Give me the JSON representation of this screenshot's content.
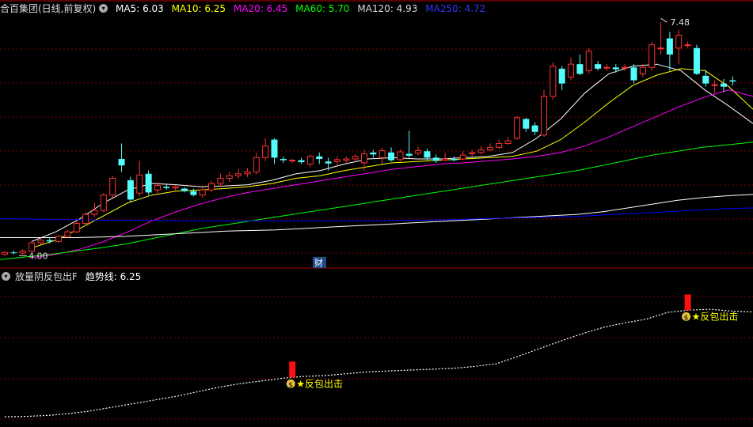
{
  "main_header": {
    "title": "合百集团(日线,前复权)",
    "ma5": "MA5: 6.03",
    "ma10": "MA10: 6.25",
    "ma20": "MA20: 6.45",
    "ma60": "MA60: 5.70",
    "ma120": "MA120: 4.93",
    "ma250": "MA250: 4.72"
  },
  "sub_header": {
    "indicator": "放量阴反包出F",
    "trend": "趋势线: 6.25"
  },
  "colors": {
    "background": "#000000",
    "up": "#ff3232",
    "down": "#54fcfc",
    "ma5": "#ffffff",
    "ma10": "#ffff00",
    "ma20": "#ff00ff",
    "ma60": "#00ff00",
    "ma120": "#ffffff",
    "ma250": "#0000ff",
    "grid": "#800000",
    "signal_text": "#ffff00"
  },
  "chart_data": {
    "type": "candlestick",
    "price_range": [
      3.8,
      7.7
    ],
    "high_label": "7.48",
    "low_label": "4.00",
    "event_marker": "财",
    "candles": [
      [
        4.0,
        4.03,
        4.05,
        3.98
      ],
      [
        4.03,
        4.02,
        4.06,
        4.0
      ],
      [
        4.02,
        4.05,
        4.08,
        4.0
      ],
      [
        4.05,
        4.18,
        4.2,
        4.03
      ],
      [
        4.18,
        4.22,
        4.25,
        4.15
      ],
      [
        4.22,
        4.2,
        4.26,
        4.17
      ],
      [
        4.2,
        4.28,
        4.3,
        4.18
      ],
      [
        4.28,
        4.35,
        4.38,
        4.25
      ],
      [
        4.35,
        4.48,
        4.52,
        4.33
      ],
      [
        4.48,
        4.62,
        4.66,
        4.45
      ],
      [
        4.62,
        4.68,
        4.8,
        4.58
      ],
      [
        4.68,
        4.92,
        4.95,
        4.65
      ],
      [
        4.92,
        5.18,
        5.22,
        4.88
      ],
      [
        5.48,
        5.38,
        5.72,
        5.28
      ],
      [
        5.15,
        4.85,
        5.2,
        4.8
      ],
      [
        4.95,
        5.23,
        5.45,
        4.9
      ],
      [
        5.25,
        4.96,
        5.3,
        4.92
      ],
      [
        5.0,
        5.07,
        5.12,
        4.95
      ],
      [
        5.05,
        5.03,
        5.1,
        5.0
      ],
      [
        5.03,
        5.05,
        5.08,
        4.99
      ],
      [
        5.02,
        4.98,
        5.04,
        4.96
      ],
      [
        4.98,
        4.92,
        5.02,
        4.9
      ],
      [
        4.92,
        5.0,
        5.05,
        4.88
      ],
      [
        5.0,
        5.1,
        5.14,
        4.97
      ],
      [
        5.1,
        5.18,
        5.25,
        5.05
      ],
      [
        5.18,
        5.22,
        5.28,
        5.12
      ],
      [
        5.22,
        5.25,
        5.32,
        5.18
      ],
      [
        5.25,
        5.28,
        5.34,
        5.2
      ],
      [
        5.28,
        5.5,
        5.58,
        5.24
      ],
      [
        5.5,
        5.68,
        5.8,
        5.45
      ],
      [
        5.78,
        5.5,
        5.8,
        5.4
      ],
      [
        5.48,
        5.46,
        5.52,
        5.42
      ],
      [
        5.45,
        5.46,
        5.48,
        5.42
      ],
      [
        5.46,
        5.43,
        5.5,
        5.4
      ],
      [
        5.4,
        5.52,
        5.55,
        5.35
      ],
      [
        5.52,
        5.48,
        5.58,
        5.4
      ],
      [
        5.44,
        5.41,
        5.5,
        5.3
      ],
      [
        5.44,
        5.47,
        5.52,
        5.38
      ],
      [
        5.46,
        5.48,
        5.52,
        5.42
      ],
      [
        5.48,
        5.52,
        5.55,
        5.45
      ],
      [
        5.42,
        5.56,
        5.62,
        5.3
      ],
      [
        5.58,
        5.55,
        5.62,
        5.5
      ],
      [
        5.5,
        5.61,
        5.65,
        5.4
      ],
      [
        5.58,
        5.46,
        5.66,
        5.44
      ],
      [
        5.47,
        5.59,
        5.63,
        5.44
      ],
      [
        5.56,
        5.53,
        5.92,
        5.5
      ],
      [
        5.57,
        5.61,
        5.67,
        5.54
      ],
      [
        5.6,
        5.5,
        5.64,
        5.46
      ],
      [
        5.5,
        5.45,
        5.55,
        5.42
      ],
      [
        5.46,
        5.48,
        5.58,
        5.44
      ],
      [
        5.48,
        5.46,
        5.52,
        5.44
      ],
      [
        5.48,
        5.54,
        5.6,
        5.46
      ],
      [
        5.56,
        5.58,
        5.62,
        5.52
      ],
      [
        5.58,
        5.62,
        5.68,
        5.55
      ],
      [
        5.62,
        5.66,
        5.72,
        5.6
      ],
      [
        5.66,
        5.72,
        5.78,
        5.64
      ],
      [
        5.72,
        5.76,
        5.82,
        5.7
      ],
      [
        5.8,
        6.12,
        6.15,
        5.78
      ],
      [
        6.1,
        5.95,
        6.12,
        5.9
      ],
      [
        6.0,
        5.9,
        6.05,
        5.85
      ],
      [
        5.85,
        6.45,
        6.55,
        5.82
      ],
      [
        6.45,
        6.92,
        6.98,
        6.4
      ],
      [
        6.88,
        6.65,
        6.92,
        6.55
      ],
      [
        6.75,
        6.95,
        7.05,
        6.7
      ],
      [
        6.95,
        6.8,
        7.1,
        6.78
      ],
      [
        6.85,
        7.15,
        7.2,
        6.8
      ],
      [
        6.95,
        6.88,
        7.0,
        6.85
      ],
      [
        6.9,
        6.9,
        6.95,
        6.85
      ],
      [
        6.9,
        6.87,
        6.95,
        6.82
      ],
      [
        6.9,
        6.9,
        6.95,
        6.85
      ],
      [
        6.9,
        6.7,
        6.95,
        6.65
      ],
      [
        6.8,
        6.9,
        6.95,
        6.75
      ],
      [
        6.9,
        7.25,
        7.3,
        6.85
      ],
      [
        7.2,
        7.2,
        7.6,
        7.1
      ],
      [
        7.35,
        7.1,
        7.45,
        6.85
      ],
      [
        7.2,
        7.4,
        7.48,
        6.95
      ],
      [
        7.25,
        7.25,
        7.3,
        7.2
      ],
      [
        7.2,
        6.8,
        7.25,
        6.78
      ],
      [
        6.77,
        6.65,
        6.86,
        6.6
      ],
      [
        6.63,
        6.63,
        6.7,
        6.5
      ],
      [
        6.65,
        6.6,
        6.72,
        6.52
      ],
      [
        6.7,
        6.68,
        6.76,
        6.62
      ]
    ],
    "ma_labels": [
      "MA5",
      "MA10",
      "MA20",
      "MA60",
      "MA120",
      "MA250"
    ],
    "ma_values": {
      "MA5": [
        4.2,
        4.35,
        4.55,
        4.8,
        5.0,
        5.1,
        5.08,
        5.05,
        5.06,
        5.08,
        5.15,
        5.25,
        5.3,
        5.4,
        5.48,
        5.5,
        5.48,
        5.48,
        5.5,
        5.52,
        5.58,
        5.8,
        6.1,
        6.5,
        6.8,
        6.92,
        6.95,
        6.85,
        6.55,
        6.3,
        6.03
      ],
      "MA10": [
        4.1,
        4.22,
        4.4,
        4.6,
        4.8,
        4.92,
        4.98,
        5.0,
        5.02,
        5.05,
        5.1,
        5.18,
        5.22,
        5.3,
        5.36,
        5.42,
        5.44,
        5.46,
        5.48,
        5.5,
        5.52,
        5.6,
        5.78,
        6.05,
        6.35,
        6.62,
        6.78,
        6.88,
        6.85,
        6.6,
        6.25
      ],
      "MA20": [
        3.95,
        4.0,
        4.08,
        4.2,
        4.35,
        4.52,
        4.66,
        4.78,
        4.88,
        4.96,
        5.02,
        5.08,
        5.14,
        5.2,
        5.26,
        5.32,
        5.36,
        5.4,
        5.42,
        5.45,
        5.48,
        5.52,
        5.58,
        5.68,
        5.82,
        5.98,
        6.14,
        6.3,
        6.44,
        6.55,
        6.45
      ],
      "MA60": [
        3.92,
        3.96,
        4.0,
        4.05,
        4.1,
        4.16,
        4.24,
        4.32,
        4.4,
        4.46,
        4.52,
        4.58,
        4.64,
        4.7,
        4.76,
        4.82,
        4.88,
        4.94,
        5.0,
        5.06,
        5.12,
        5.18,
        5.24,
        5.3,
        5.38,
        5.46,
        5.54,
        5.6,
        5.66,
        5.7,
        5.74
      ],
      "MA120": [
        4.26,
        4.26,
        4.26,
        4.26,
        4.27,
        4.28,
        4.3,
        4.32,
        4.34,
        4.36,
        4.37,
        4.38,
        4.4,
        4.42,
        4.44,
        4.46,
        4.48,
        4.5,
        4.52,
        4.54,
        4.56,
        4.58,
        4.6,
        4.62,
        4.66,
        4.72,
        4.78,
        4.84,
        4.88,
        4.91,
        4.93
      ],
      "MA250": [
        4.55,
        4.55,
        4.54,
        4.54,
        4.53,
        4.53,
        4.53,
        4.52,
        4.52,
        4.52,
        4.52,
        4.52,
        4.52,
        4.52,
        4.52,
        4.52,
        4.53,
        4.53,
        4.54,
        4.55,
        4.56,
        4.57,
        4.58,
        4.59,
        4.61,
        4.63,
        4.65,
        4.67,
        4.69,
        4.71,
        4.72
      ]
    },
    "sub_range": [
      4.5,
      7.2
    ],
    "trend_line": [
      4.55,
      4.56,
      4.58,
      4.62,
      4.68,
      4.76,
      4.84,
      4.92,
      5.0,
      5.1,
      5.2,
      5.28,
      5.34,
      5.4,
      5.44,
      5.46,
      5.5,
      5.54,
      5.56,
      5.58,
      5.6,
      5.62,
      5.66,
      5.72,
      5.88,
      6.05,
      6.22,
      6.38,
      6.52,
      6.62,
      6.7,
      6.85,
      6.9,
      6.92,
      6.88,
      6.86
    ],
    "signals": [
      {
        "candle": 32,
        "label": "反包出击"
      },
      {
        "candle": 76,
        "label": "反包出击"
      }
    ]
  }
}
